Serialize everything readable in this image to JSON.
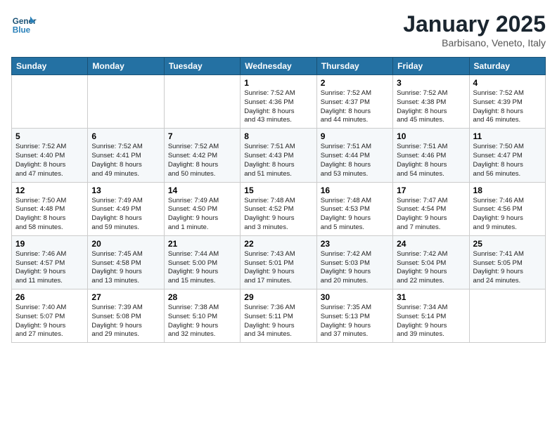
{
  "header": {
    "logo_line1": "General",
    "logo_line2": "Blue",
    "month": "January 2025",
    "location": "Barbisano, Veneto, Italy"
  },
  "weekdays": [
    "Sunday",
    "Monday",
    "Tuesday",
    "Wednesday",
    "Thursday",
    "Friday",
    "Saturday"
  ],
  "weeks": [
    [
      {
        "day": "",
        "info": ""
      },
      {
        "day": "",
        "info": ""
      },
      {
        "day": "",
        "info": ""
      },
      {
        "day": "1",
        "info": "Sunrise: 7:52 AM\nSunset: 4:36 PM\nDaylight: 8 hours\nand 43 minutes."
      },
      {
        "day": "2",
        "info": "Sunrise: 7:52 AM\nSunset: 4:37 PM\nDaylight: 8 hours\nand 44 minutes."
      },
      {
        "day": "3",
        "info": "Sunrise: 7:52 AM\nSunset: 4:38 PM\nDaylight: 8 hours\nand 45 minutes."
      },
      {
        "day": "4",
        "info": "Sunrise: 7:52 AM\nSunset: 4:39 PM\nDaylight: 8 hours\nand 46 minutes."
      }
    ],
    [
      {
        "day": "5",
        "info": "Sunrise: 7:52 AM\nSunset: 4:40 PM\nDaylight: 8 hours\nand 47 minutes."
      },
      {
        "day": "6",
        "info": "Sunrise: 7:52 AM\nSunset: 4:41 PM\nDaylight: 8 hours\nand 49 minutes."
      },
      {
        "day": "7",
        "info": "Sunrise: 7:52 AM\nSunset: 4:42 PM\nDaylight: 8 hours\nand 50 minutes."
      },
      {
        "day": "8",
        "info": "Sunrise: 7:51 AM\nSunset: 4:43 PM\nDaylight: 8 hours\nand 51 minutes."
      },
      {
        "day": "9",
        "info": "Sunrise: 7:51 AM\nSunset: 4:44 PM\nDaylight: 8 hours\nand 53 minutes."
      },
      {
        "day": "10",
        "info": "Sunrise: 7:51 AM\nSunset: 4:46 PM\nDaylight: 8 hours\nand 54 minutes."
      },
      {
        "day": "11",
        "info": "Sunrise: 7:50 AM\nSunset: 4:47 PM\nDaylight: 8 hours\nand 56 minutes."
      }
    ],
    [
      {
        "day": "12",
        "info": "Sunrise: 7:50 AM\nSunset: 4:48 PM\nDaylight: 8 hours\nand 58 minutes."
      },
      {
        "day": "13",
        "info": "Sunrise: 7:49 AM\nSunset: 4:49 PM\nDaylight: 8 hours\nand 59 minutes."
      },
      {
        "day": "14",
        "info": "Sunrise: 7:49 AM\nSunset: 4:50 PM\nDaylight: 9 hours\nand 1 minute."
      },
      {
        "day": "15",
        "info": "Sunrise: 7:48 AM\nSunset: 4:52 PM\nDaylight: 9 hours\nand 3 minutes."
      },
      {
        "day": "16",
        "info": "Sunrise: 7:48 AM\nSunset: 4:53 PM\nDaylight: 9 hours\nand 5 minutes."
      },
      {
        "day": "17",
        "info": "Sunrise: 7:47 AM\nSunset: 4:54 PM\nDaylight: 9 hours\nand 7 minutes."
      },
      {
        "day": "18",
        "info": "Sunrise: 7:46 AM\nSunset: 4:56 PM\nDaylight: 9 hours\nand 9 minutes."
      }
    ],
    [
      {
        "day": "19",
        "info": "Sunrise: 7:46 AM\nSunset: 4:57 PM\nDaylight: 9 hours\nand 11 minutes."
      },
      {
        "day": "20",
        "info": "Sunrise: 7:45 AM\nSunset: 4:58 PM\nDaylight: 9 hours\nand 13 minutes."
      },
      {
        "day": "21",
        "info": "Sunrise: 7:44 AM\nSunset: 5:00 PM\nDaylight: 9 hours\nand 15 minutes."
      },
      {
        "day": "22",
        "info": "Sunrise: 7:43 AM\nSunset: 5:01 PM\nDaylight: 9 hours\nand 17 minutes."
      },
      {
        "day": "23",
        "info": "Sunrise: 7:42 AM\nSunset: 5:03 PM\nDaylight: 9 hours\nand 20 minutes."
      },
      {
        "day": "24",
        "info": "Sunrise: 7:42 AM\nSunset: 5:04 PM\nDaylight: 9 hours\nand 22 minutes."
      },
      {
        "day": "25",
        "info": "Sunrise: 7:41 AM\nSunset: 5:05 PM\nDaylight: 9 hours\nand 24 minutes."
      }
    ],
    [
      {
        "day": "26",
        "info": "Sunrise: 7:40 AM\nSunset: 5:07 PM\nDaylight: 9 hours\nand 27 minutes."
      },
      {
        "day": "27",
        "info": "Sunrise: 7:39 AM\nSunset: 5:08 PM\nDaylight: 9 hours\nand 29 minutes."
      },
      {
        "day": "28",
        "info": "Sunrise: 7:38 AM\nSunset: 5:10 PM\nDaylight: 9 hours\nand 32 minutes."
      },
      {
        "day": "29",
        "info": "Sunrise: 7:36 AM\nSunset: 5:11 PM\nDaylight: 9 hours\nand 34 minutes."
      },
      {
        "day": "30",
        "info": "Sunrise: 7:35 AM\nSunset: 5:13 PM\nDaylight: 9 hours\nand 37 minutes."
      },
      {
        "day": "31",
        "info": "Sunrise: 7:34 AM\nSunset: 5:14 PM\nDaylight: 9 hours\nand 39 minutes."
      },
      {
        "day": "",
        "info": ""
      }
    ]
  ]
}
